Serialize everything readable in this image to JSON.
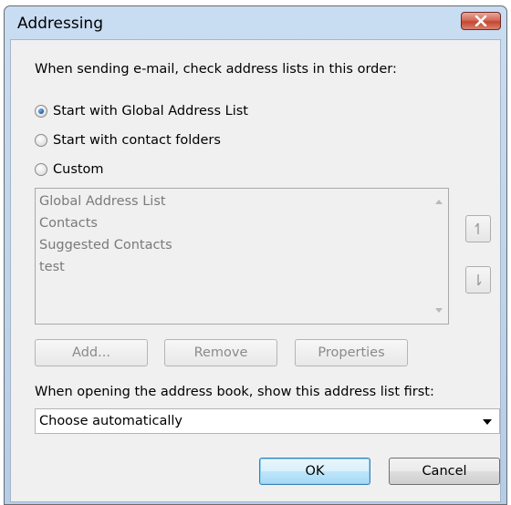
{
  "window": {
    "title": "Addressing",
    "close_icon": "close-x-icon"
  },
  "search_order": {
    "heading": "When sending e-mail, check address lists in this order:",
    "options": [
      {
        "label": "Start with Global Address List",
        "checked": true
      },
      {
        "label": "Start with contact folders",
        "checked": false
      },
      {
        "label": "Custom",
        "checked": false
      }
    ]
  },
  "address_list": {
    "items": [
      "Global Address List",
      "Contacts",
      "Suggested Contacts",
      "test"
    ],
    "move_up_icon": "arrow-up-icon",
    "move_down_icon": "arrow-down-icon"
  },
  "list_buttons": {
    "add": "Add...",
    "remove": "Remove",
    "properties": "Properties"
  },
  "address_book": {
    "heading": "When opening the address book, show this address list first:",
    "selected": "Choose automatically"
  },
  "footer": {
    "ok": "OK",
    "cancel": "Cancel"
  },
  "colors": {
    "title_bar": "#c9ddf2",
    "close_button": "#c44630",
    "client_bg": "#f0f0f0",
    "disabled_text": "#7a7a7a"
  }
}
